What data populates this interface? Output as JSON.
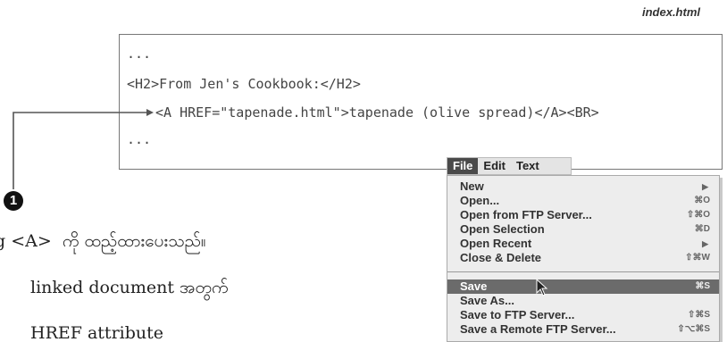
{
  "filename": "index.html",
  "code": {
    "line1": "...",
    "line2": "<H2>From Jen's Cookbook:</H2>",
    "line3": "<A HREF=\"tapenade.html\">tapenade (olive spread)</A><BR>",
    "line4": "..."
  },
  "callout": {
    "number": "❶",
    "note_line1": "g <A>  ကို ထည့်ထားပေးသည်။",
    "note_line2": "linked document အတွက်",
    "note_line3": "HREF attribute"
  },
  "menubar": {
    "items": [
      "File",
      "Edit",
      "Text"
    ],
    "active": "File"
  },
  "file_menu": {
    "items": [
      {
        "label": "New",
        "shortcut": "",
        "submenu": true
      },
      {
        "label": "Open...",
        "shortcut": "⌘O",
        "submenu": false
      },
      {
        "label": "Open from FTP Server...",
        "shortcut": "⇧⌘O",
        "submenu": false
      },
      {
        "label": "Open Selection",
        "shortcut": "⌘D",
        "submenu": false
      },
      {
        "label": "Open Recent",
        "shortcut": "",
        "submenu": true
      },
      {
        "label": "Close & Delete",
        "shortcut": "⇧⌘W",
        "submenu": false
      },
      {
        "label": "Save",
        "shortcut": "⌘S",
        "submenu": false,
        "highlighted": true
      },
      {
        "label": "Save As...",
        "shortcut": "",
        "submenu": false
      },
      {
        "label": "Save to FTP Server...",
        "shortcut": "⇧⌘S",
        "submenu": false
      },
      {
        "label": "Save a Remote FTP Server...",
        "shortcut": "⇧⌥⌘S",
        "submenu": false
      }
    ]
  },
  "colors": {
    "highlight": "#6b6b6b",
    "menu_bg": "#ededed",
    "callout_line": "#555555"
  }
}
